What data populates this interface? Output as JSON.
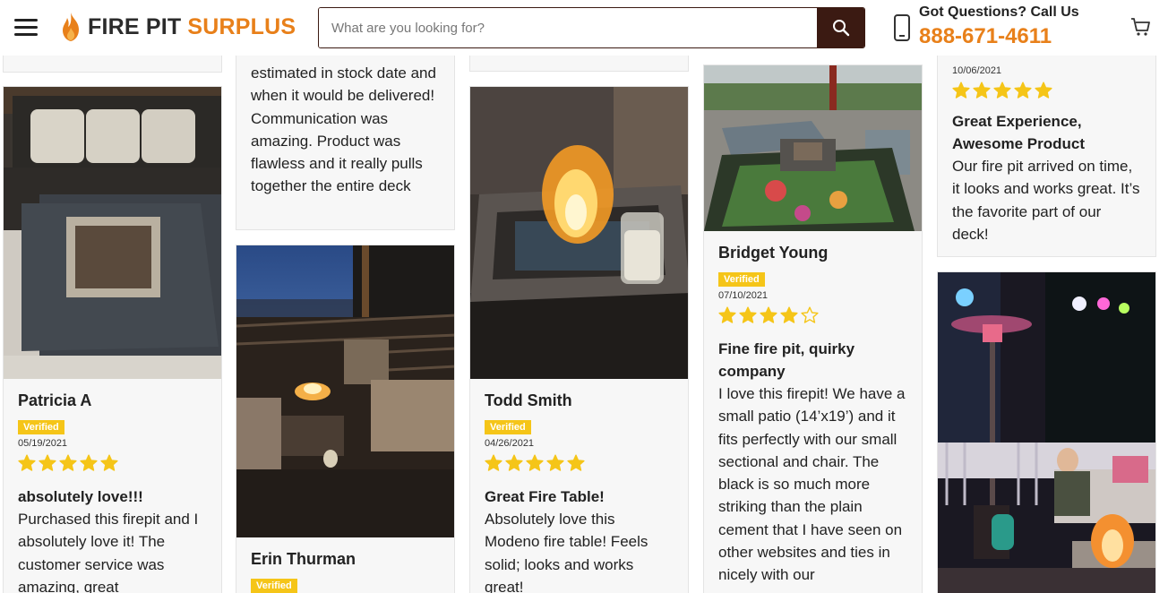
{
  "header": {
    "logo_part1": "FIRE PIT",
    "logo_part2": "SURPLUS",
    "search_placeholder": "What are you looking for?",
    "contact_question": "Got Questions? Call Us",
    "contact_phone": "888-671-4611",
    "icons": [
      "menu-icon",
      "flame-icon",
      "search-icon",
      "phone-icon",
      "cart-icon"
    ]
  },
  "colors": {
    "brand_orange": "#e8801a",
    "brand_dark": "#3b1a12",
    "verified_badge": "#f5c518",
    "star": "#f5c518"
  },
  "reviews": [
    {
      "name": "Patricia A",
      "badge": "Verified",
      "date": "05/19/2021",
      "rating": 5,
      "title": "absolutely love!!!",
      "text": "Purchased this firepit and I absolutely love it! The customer service was amazing, great"
    },
    {
      "text": "estimated in stock date and when it would be delivered! Communication was amazing. Product was flawless and it really pulls together the entire deck"
    },
    {
      "name": "Erin Thurman",
      "badge": "Verified"
    },
    {
      "name": "Todd Smith",
      "badge": "Verified",
      "date": "04/26/2021",
      "rating": 5,
      "title": "Great Fire Table!",
      "text": "Absolutely love this Modeno fire table! Feels solid; looks and works great!"
    },
    {
      "name": "Bridget Young",
      "badge": "Verified",
      "date": "07/10/2021",
      "rating": 4,
      "title": "Fine fire pit, quirky company",
      "text": "I love this firepit! We have a small patio (14’x19’) and it fits perfectly with our small sectional and chair. The black is so much more striking than the plain cement that I have seen on other websites and ties in nicely with our"
    },
    {
      "date": "10/06/2021",
      "rating": 5,
      "title": "Great Experience, Awesome Product",
      "text": "Our fire pit arrived on time, it looks and works great. It’s the favorite part of our deck!"
    }
  ]
}
